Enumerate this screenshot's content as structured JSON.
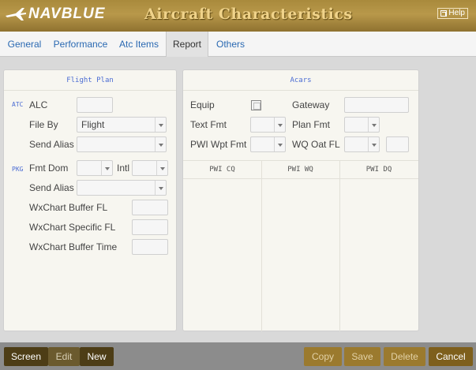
{
  "header": {
    "brand": "NAVBLUE",
    "title": "Aircraft Characteristics",
    "help_label": "Help"
  },
  "tabs": [
    {
      "label": "General"
    },
    {
      "label": "Performance"
    },
    {
      "label": "Atc Items"
    },
    {
      "label": "Report",
      "active": true
    },
    {
      "label": "Others"
    }
  ],
  "flight_plan": {
    "title": "Flight Plan",
    "atc_tag": "ATC",
    "pkg_tag": "PKG",
    "alc_label": "ALC",
    "alc_value": "",
    "file_by_label": "File By",
    "file_by_value": "Flight",
    "send_alias_label": "Send Alias",
    "send_alias_value": "",
    "fmt_dom_label": "Fmt Dom",
    "fmt_dom_value": "",
    "intl_label": "Intl",
    "intl_value": "",
    "pkg_send_alias_label": "Send Alias",
    "pkg_send_alias_value": "",
    "wx_buffer_fl_label": "WxChart Buffer FL",
    "wx_specific_fl_label": "WxChart Specific FL",
    "wx_buffer_time_label": "WxChart Buffer Time"
  },
  "acars": {
    "title": "Acars",
    "equip_label": "Equip",
    "equip_checked": false,
    "gateway_label": "Gateway",
    "text_fmt_label": "Text Fmt",
    "plan_fmt_label": "Plan Fmt",
    "pwi_wpt_fmt_label": "PWI Wpt Fmt",
    "wq_oat_fl_label": "WQ Oat FL",
    "columns": [
      "PWI CQ",
      "PWI WQ",
      "PWI DQ"
    ]
  },
  "bottom": {
    "screen": "Screen",
    "edit": "Edit",
    "new": "New",
    "copy": "Copy",
    "save": "Save",
    "delete": "Delete",
    "cancel": "Cancel"
  }
}
